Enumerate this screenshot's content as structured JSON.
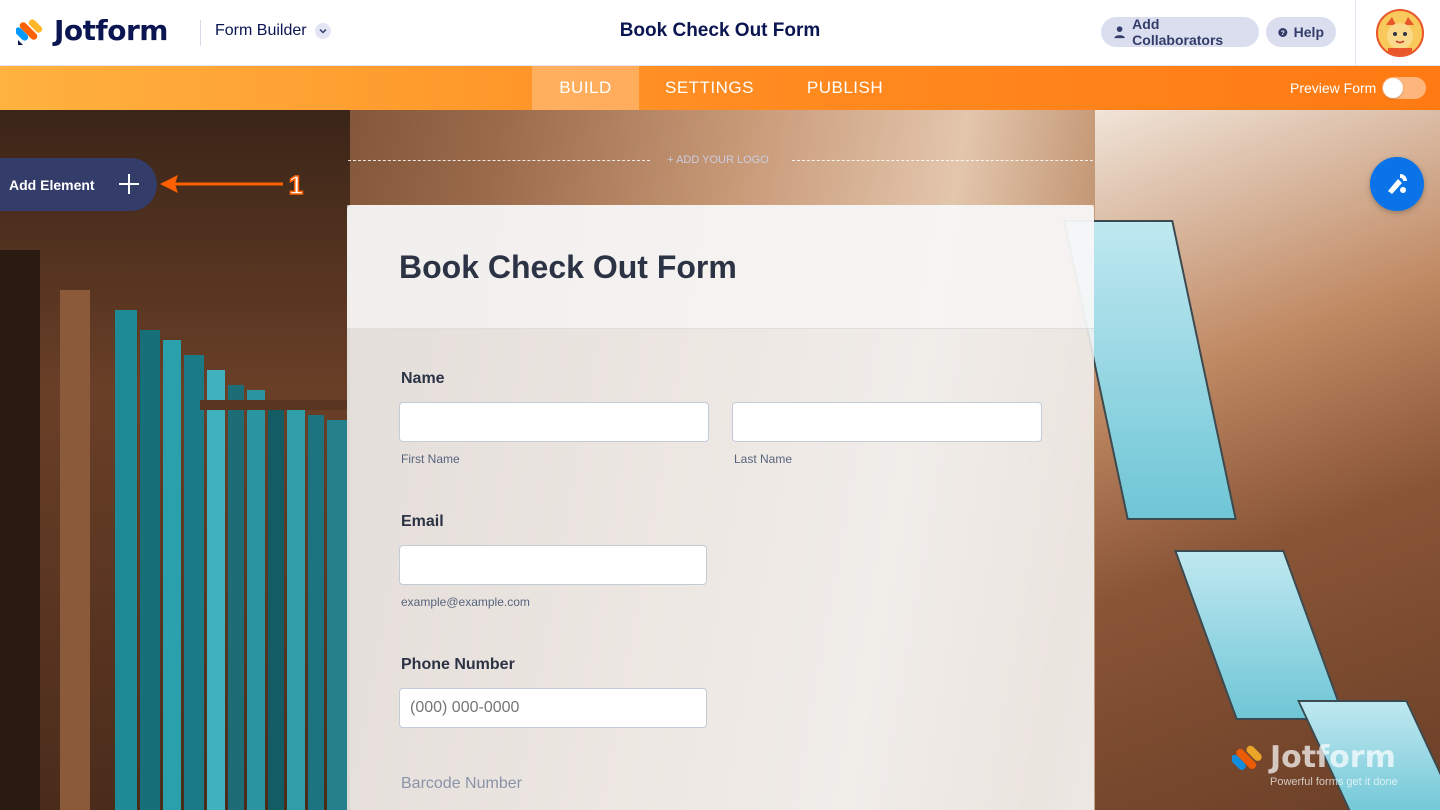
{
  "header": {
    "brand": "Jotform",
    "builder_label": "Form Builder",
    "title": "Book Check Out Form",
    "collab_label": "Add Collaborators",
    "help_label": "Help"
  },
  "nav": {
    "tabs": [
      {
        "label": "BUILD",
        "active": true
      },
      {
        "label": "SETTINGS",
        "active": false
      },
      {
        "label": "PUBLISH",
        "active": false
      }
    ],
    "preview_label": "Preview Form",
    "preview_on": false
  },
  "sidebar": {
    "add_element_label": "Add Element",
    "annotation_number": "1"
  },
  "logo_slot": {
    "label": "+ ADD YOUR LOGO"
  },
  "form": {
    "title": "Book Check Out Form",
    "fields": {
      "name": {
        "label": "Name",
        "first_sublabel": "First Name",
        "last_sublabel": "Last Name",
        "first_value": "",
        "last_value": ""
      },
      "email": {
        "label": "Email",
        "sublabel": "example@example.com",
        "value": ""
      },
      "phone": {
        "label": "Phone Number",
        "placeholder": "(000) 000-0000"
      },
      "barcode": {
        "label": "Barcode Number"
      }
    }
  },
  "watermark": {
    "brand": "Jotform",
    "tagline": "Powerful forms get it done"
  },
  "colors": {
    "navy": "#0a1551",
    "orange": "#ff7a12",
    "blue": "#0a73e8",
    "panel": "#343c6a"
  }
}
